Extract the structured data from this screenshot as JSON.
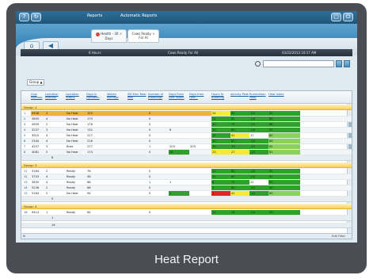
{
  "caption": "Heat Report",
  "menu": {
    "reports": "Reports",
    "automatic_reports": "Automatic Reports"
  },
  "tabs": [
    {
      "line1": "Health - 30",
      "line2": "Days"
    },
    {
      "line1": "Cows Ready",
      "line2": "For AI"
    }
  ],
  "status_bar": {
    "left": "6 Hours",
    "center": "Cows Ready For All",
    "right": "03/22/2013 10:17 AM"
  },
  "group_chip": "Group ▲",
  "columns": [
    "Cow Number",
    "Lactation Number",
    "Lactation Status",
    "Days in Lactation",
    "Weeks Average",
    "SM Max Total Milk",
    "Number of Breedings",
    "Days From Last Insem",
    "Days from Last...",
    "Hours To Breeding",
    "Activity Peak",
    "Rumination Peak",
    "Heat Index"
  ],
  "groups": [
    {
      "title": "Group: 1",
      "rows": [
        {
          "idx": "1",
          "cells": [
            "9908",
            "3",
            "No Heat",
            "150",
            "",
            "",
            "0",
            "",
            "",
            "24",
            "81",
            "-20",
            "91"
          ]
        },
        {
          "idx": "2",
          "cells": [
            "3605",
            "4",
            "No Heat",
            "170",
            "",
            "",
            "0",
            "",
            "",
            "12",
            "81",
            "-26",
            "89"
          ]
        },
        {
          "idx": "3",
          "cells": [
            "4909",
            "2",
            "No Heat",
            "178",
            "",
            "",
            "0",
            "",
            "",
            "10",
            "75",
            "-25",
            "88"
          ]
        },
        {
          "idx": "4",
          "cells": [
            "3237",
            "3",
            "No Heat",
            "132",
            "",
            "",
            "0",
            "6",
            "",
            "10",
            "80",
            "-26",
            "91"
          ]
        },
        {
          "idx": "5",
          "cells": [
            "3910",
            "4",
            "No Heat",
            "227",
            "",
            "",
            "0",
            "",
            "",
            "12",
            "41",
            "17",
            "85"
          ]
        },
        {
          "idx": "6",
          "cells": [
            "2344",
            "4",
            "No Heat",
            "218",
            "",
            "",
            "0",
            "",
            "",
            "10",
            "80",
            "-20",
            "86"
          ]
        },
        {
          "idx": "7",
          "cells": [
            "4257",
            "3",
            "Bred",
            "277",
            "",
            "",
            "1",
            "203",
            "203",
            "15",
            "79",
            "-25",
            "82"
          ]
        },
        {
          "idx": "8",
          "cells": [
            "4081",
            "5",
            "No Heat",
            "174",
            "",
            "",
            "0",
            "26",
            "",
            "23",
            "27",
            "-15",
            "81"
          ]
        }
      ],
      "summary": "8"
    },
    {
      "title": "Group: 3",
      "rows": [
        {
          "idx": "11",
          "cells": [
            "3164",
            "2",
            "Ready",
            "76",
            "",
            "",
            "0",
            "",
            "",
            "12",
            "60",
            "-20",
            "91"
          ]
        },
        {
          "idx": "12",
          "cells": [
            "3703",
            "4",
            "Ready",
            "58",
            "",
            "",
            "0",
            "",
            "",
            "12",
            "60",
            "-20",
            "91"
          ]
        },
        {
          "idx": "13",
          "cells": [
            "3635",
            "4",
            "Ready",
            "68",
            "",
            "",
            "1",
            "1",
            "",
            "6",
            "71",
            "22",
            "90"
          ]
        },
        {
          "idx": "14",
          "cells": [
            "5236",
            "2",
            "Ready",
            "66",
            "",
            "",
            "0",
            "",
            "",
            "5",
            "80",
            "-20",
            "90"
          ]
        },
        {
          "idx": "15",
          "cells": [
            "5164",
            "2",
            "No Heat",
            "94",
            "",
            "",
            "0",
            "2",
            "",
            "1",
            "41",
            "-10",
            "85"
          ]
        }
      ],
      "summary": "5"
    },
    {
      "title": "Group: 4",
      "rows": [
        {
          "idx": "16",
          "cells": [
            "9414",
            "1",
            "Ready",
            "64",
            "",
            "",
            "0",
            "",
            "",
            "11",
            "54",
            "-20",
            "90"
          ]
        }
      ],
      "summary": "1"
    }
  ],
  "grand_total": "14",
  "footer_right": "Edit Filter",
  "colors": {
    "green": "#2fa12a",
    "light_green": "#8bd15a",
    "yellow": "#f4ea3c",
    "red": "#e0281f",
    "orange": "#f2b13b"
  }
}
